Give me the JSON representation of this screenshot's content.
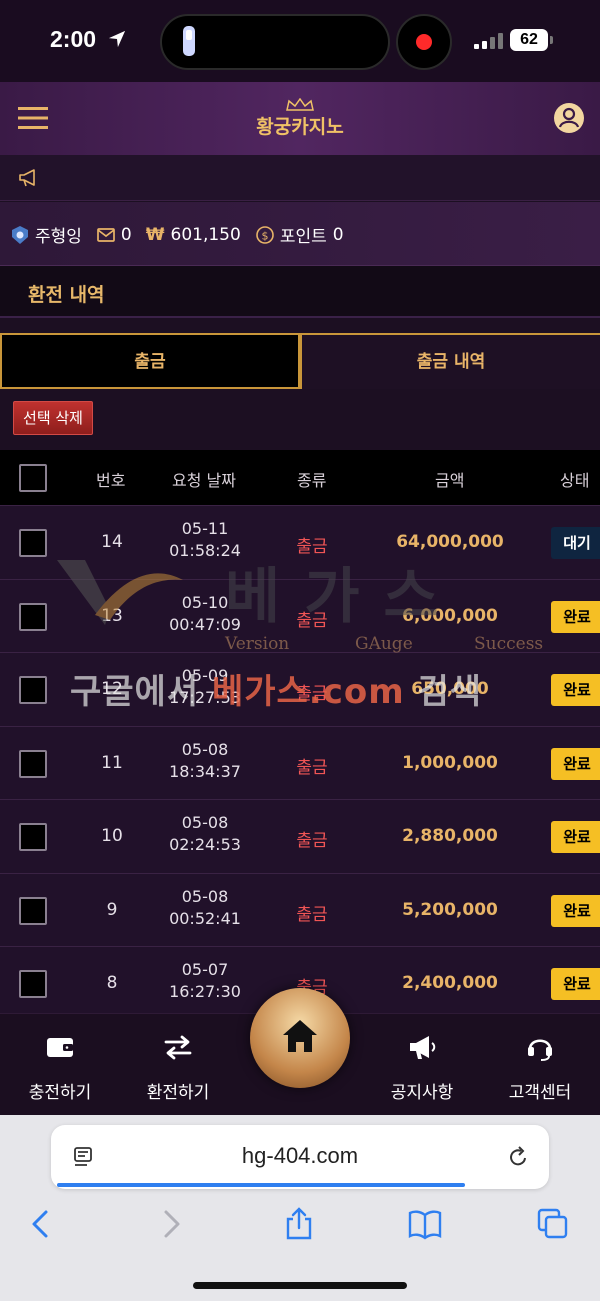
{
  "status_bar": {
    "time": "2:00",
    "battery": "62"
  },
  "header": {
    "logo_text": "황궁카지노"
  },
  "user": {
    "name": "주형잉",
    "messages": "0",
    "balance_symbol": "₩",
    "balance": "601,150",
    "points_label": "포인트",
    "points": "0"
  },
  "section_title": "환전 내역",
  "tabs": [
    {
      "label": "출금"
    },
    {
      "label": "출금 내역"
    }
  ],
  "delete_button": "선택 삭제",
  "table": {
    "headers": [
      "번호",
      "요청 날짜",
      "종류",
      "금액",
      "상태"
    ],
    "rows": [
      {
        "no": "14",
        "date": "05-11",
        "time": "01:58:24",
        "type": "출금",
        "amount": "64,000,000",
        "status": "대기"
      },
      {
        "no": "13",
        "date": "05-10",
        "time": "00:47:09",
        "type": "출금",
        "amount": "6,000,000",
        "status": "완료"
      },
      {
        "no": "12",
        "date": "05-09",
        "time": "17:27:53",
        "type": "출금",
        "amount": "650,000",
        "status": "완료"
      },
      {
        "no": "11",
        "date": "05-08",
        "time": "18:34:37",
        "type": "출금",
        "amount": "1,000,000",
        "status": "완료"
      },
      {
        "no": "10",
        "date": "05-08",
        "time": "02:24:53",
        "type": "출금",
        "amount": "2,880,000",
        "status": "완료"
      },
      {
        "no": "9",
        "date": "05-08",
        "time": "00:52:41",
        "type": "출금",
        "amount": "5,200,000",
        "status": "완료"
      },
      {
        "no": "8",
        "date": "05-07",
        "time": "16:27:30",
        "type": "출금",
        "amount": "2,400,000",
        "status": "완료"
      }
    ]
  },
  "watermark": {
    "big": "베가스",
    "sub1": "Version",
    "sub2": "GAuge",
    "sub3": "Success",
    "line_a": "구글에서 ",
    "line_b": "베가스.com",
    "line_c": " 검색"
  },
  "bottom_nav": {
    "deposit": "충전하기",
    "exchange": "환전하기",
    "notice": "공지사항",
    "support": "고객센터"
  },
  "browser": {
    "url": "hg-404.com"
  },
  "colors": {
    "accent_gold": "#e8b468",
    "withdraw_red": "#f05555",
    "badge_done": "#f5bf24",
    "badge_wait": "#0f2540"
  }
}
